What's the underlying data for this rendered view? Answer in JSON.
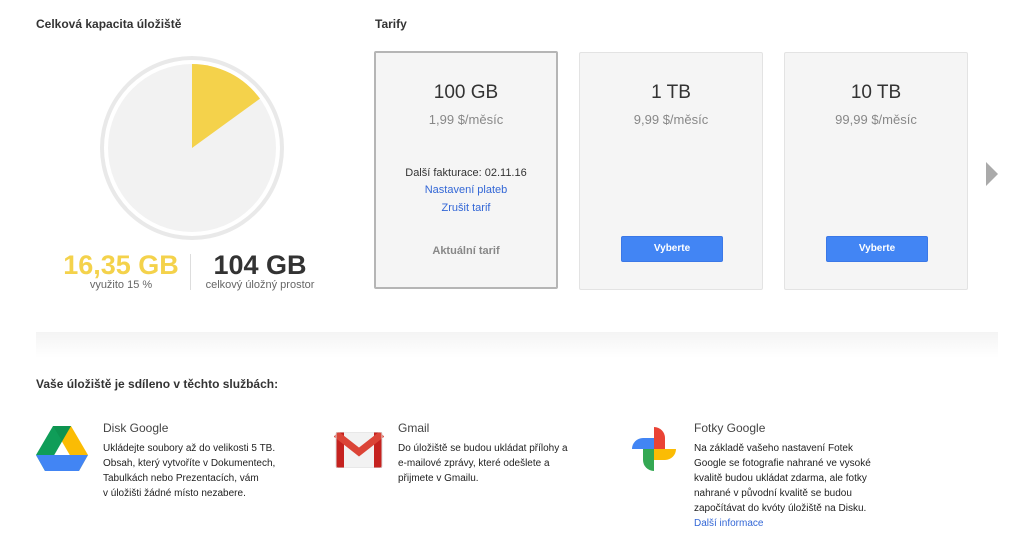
{
  "storage": {
    "title": "Celková kapacita úložiště",
    "used_value": "16,35 GB",
    "used_label": "využito 15 %",
    "used_fraction": 0.15,
    "total_value": "104 GB",
    "total_label": "celkový úložný prostor"
  },
  "plans": {
    "title": "Tarify",
    "items": [
      {
        "size": "100 GB",
        "price": "1,99 $/měsíc",
        "billing": "Další fakturace: 02.11.16",
        "payment_settings_link": "Nastavení plateb",
        "cancel_link": "Zrušit tarif",
        "current_label": "Aktuální tarif"
      },
      {
        "size": "1 TB",
        "price": "9,99 $/měsíc",
        "button": "Vyberte"
      },
      {
        "size": "10 TB",
        "price": "99,99 $/měsíc",
        "button": "Vyberte"
      }
    ]
  },
  "services": {
    "title": "Vaše úložiště je sdíleno v těchto službách:",
    "items": [
      {
        "name": "Disk Google",
        "lines": [
          "Ukládejte soubory až do velikosti 5 TB.",
          "Obsah, který vytvoříte v Dokumentech,",
          "Tabulkách nebo Prezentacích, vám",
          "v úložišti žádné místo nezabere."
        ]
      },
      {
        "name": "Gmail",
        "lines": [
          "Do úložiště se budou ukládat přílohy a",
          "e-mailové zprávy, které odešlete a",
          "přijmete v Gmailu."
        ]
      },
      {
        "name": "Fotky Google",
        "lines": [
          "Na základě vašeho nastavení Fotek",
          "Google se fotografie nahrané ve vysoké",
          "kvalitě budou ukládat zdarma, ale fotky",
          "nahrané v původní kvalitě se budou",
          "započítávat do kvóty úložiště na Disku."
        ],
        "link": "Další informace"
      }
    ]
  },
  "colors": {
    "used": "#f4d24b",
    "pie_background": "#f2f2f2",
    "accent_button": "#4285f4",
    "link": "#3367d6"
  },
  "icons": {
    "next": "chevron-right-icon",
    "drive": "google-drive-icon",
    "gmail": "gmail-icon",
    "photos": "google-photos-icon"
  }
}
